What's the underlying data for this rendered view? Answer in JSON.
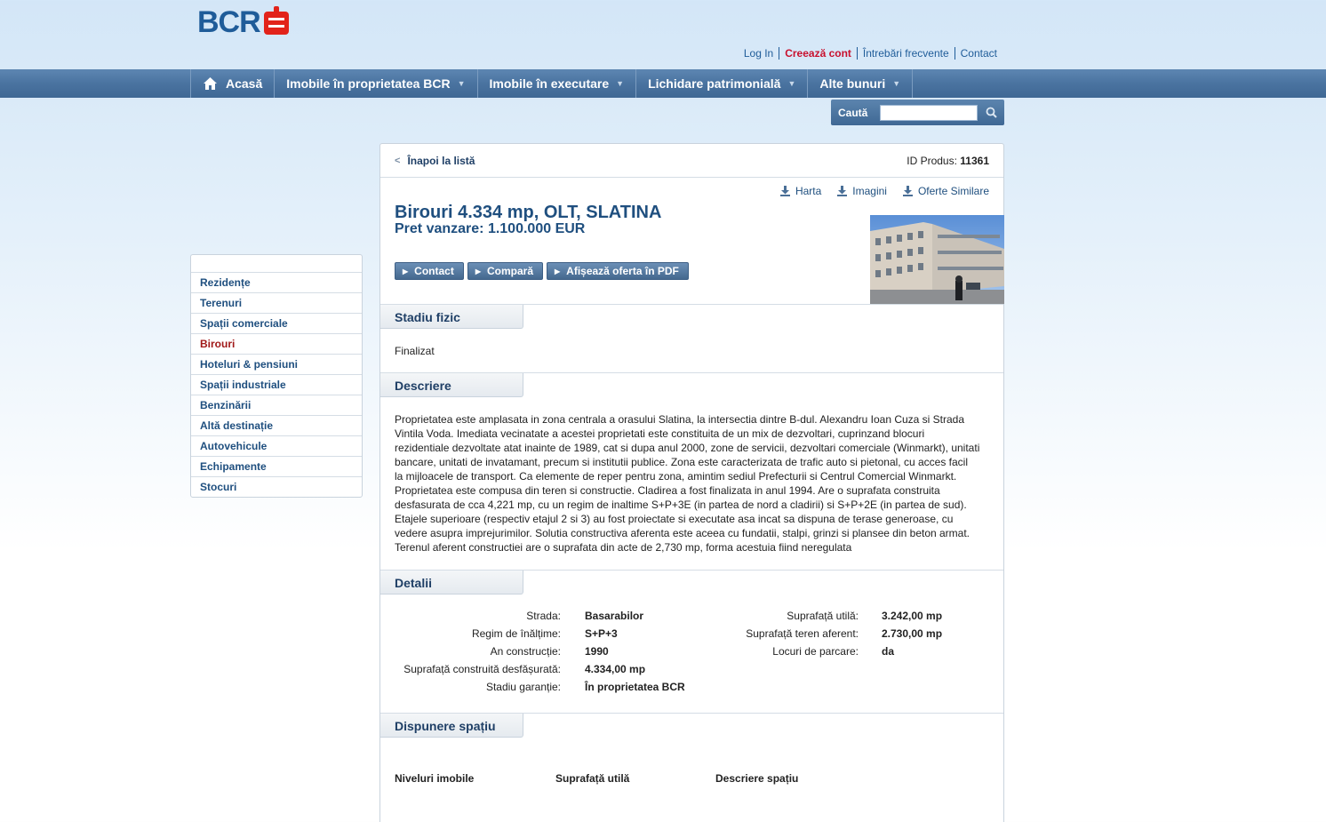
{
  "header": {
    "logo_text": "BCR",
    "links": [
      {
        "label": "Log In",
        "style": "normal"
      },
      {
        "label": "Creează cont",
        "style": "red"
      },
      {
        "label": "Întrebări frecvente",
        "style": "normal"
      },
      {
        "label": "Contact",
        "style": "normal"
      }
    ]
  },
  "nav": {
    "home": "Acasă",
    "items": [
      "Imobile în proprietatea BCR",
      "Imobile în executare",
      "Lichidare patrimonială",
      "Alte bunuri"
    ]
  },
  "search": {
    "label": "Caută",
    "value": ""
  },
  "sidebar": {
    "items": [
      "Rezidențe",
      "Terenuri",
      "Spații comerciale",
      "Birouri",
      "Hoteluri & pensiuni",
      "Spații industriale",
      "Benzinării",
      "Altă destinație",
      "Autovehicule",
      "Echipamente",
      "Stocuri"
    ],
    "active_index": 3
  },
  "product": {
    "back_label": "Înapoi la listă",
    "id_label": "ID Produs:",
    "id_value": "11361",
    "actions": [
      "Harta",
      "Imagini",
      "Oferte Similare"
    ],
    "title": "Birouri 4.334 mp, OLT, SLATINA",
    "price": "Pret vanzare: 1.100.000 EUR",
    "buttons": [
      "Contact",
      "Compară",
      "Afișează oferta în PDF"
    ]
  },
  "stadiu": {
    "heading": "Stadiu fizic",
    "value": "Finalizat"
  },
  "descriere": {
    "heading": "Descriere",
    "lines": [
      "Proprietatea este amplasata in zona centrala a orasului Slatina, la intersectia dintre B-dul. Alexandru Ioan Cuza si Strada",
      "Vintila Voda. Imediata vecinatate a acestei proprietati este constituita de un mix de dezvoltari, cuprinzand blocuri",
      "rezidentiale dezvoltate atat inainte de 1989, cat si dupa anul 2000, zone de servicii, dezvoltari comerciale (Winmarkt), unitati",
      "bancare, unitati de invatamant, precum si institutii publice. Zona este caracterizata de trafic auto si pietonal, cu acces facil",
      "la mijloacele de transport. Ca elemente de reper pentru zona, amintim sediul Prefecturii si Centrul Comercial Winmarkt.",
      "Proprietatea este compusa din teren si constructie. Cladirea a fost finalizata in anul 1994. Are o suprafata construita",
      "desfasurata de cca 4,221 mp, cu un regim de inaltime S+P+3E (in partea de nord a cladirii) si S+P+2E (in partea de sud).",
      "Etajele superioare (respectiv etajul 2 si 3) au fost proiectate si executate asa incat sa dispuna de terase generoase, cu",
      "vedere asupra imprejurimilor. Solutia constructiva aferenta este aceea cu fundatii, stalpi, grinzi si plansee din beton armat.",
      "Terenul aferent constructiei are o suprafata din acte de 2,730 mp, forma acestuia fiind neregulata"
    ]
  },
  "detalii": {
    "heading": "Detalii",
    "left": [
      {
        "label": "Strada:",
        "value": "Basarabilor"
      },
      {
        "label": "Regim de înălțime:",
        "value": "S+P+3"
      },
      {
        "label": "An construcție:",
        "value": "1990"
      },
      {
        "label": "Suprafață construită desfășurată:",
        "value": "4.334,00 mp"
      },
      {
        "label": "Stadiu garanție:",
        "value": "În proprietatea BCR"
      }
    ],
    "right": [
      {
        "label": "Suprafață utilă:",
        "value": "3.242,00 mp"
      },
      {
        "label": "Suprafață teren aferent:",
        "value": "2.730,00 mp"
      },
      {
        "label": "Locuri de parcare:",
        "value": "da"
      }
    ]
  },
  "dispunere": {
    "heading": "Dispunere spațiu",
    "columns": [
      "Niveluri imobile",
      "Suprafață utilă",
      "Descriere spațiu"
    ]
  },
  "colors": {
    "brand_blue": "#1f5c99",
    "brand_red": "#c8102e",
    "nav_blue": "#4a73a0"
  }
}
